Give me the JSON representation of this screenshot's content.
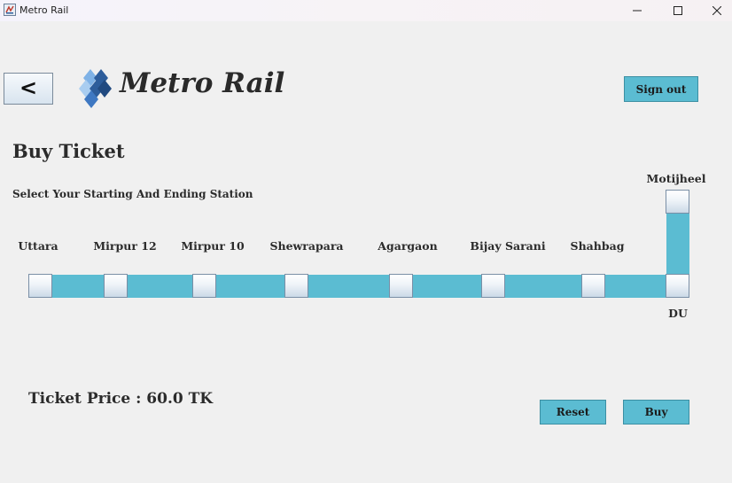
{
  "window": {
    "title": "Metro Rail",
    "controls": {
      "minimize": "minimize-icon",
      "maximize": "maximize-icon",
      "close": "close-icon"
    }
  },
  "header": {
    "back_label": "<",
    "brand": "Metro Rail",
    "sign_out_label": "Sign out"
  },
  "page": {
    "heading": "Buy Ticket",
    "instruction": "Select Your Starting And Ending Station"
  },
  "stations": [
    {
      "name": "Uttara"
    },
    {
      "name": "Mirpur 12"
    },
    {
      "name": "Mirpur 10"
    },
    {
      "name": "Shewrapara"
    },
    {
      "name": "Agargaon"
    },
    {
      "name": "Bijay Sarani"
    },
    {
      "name": "Shahbag"
    },
    {
      "name": "DU"
    },
    {
      "name": "Motijheel"
    }
  ],
  "ticket": {
    "price_text": "Ticket Price : 60.0 TK"
  },
  "actions": {
    "reset_label": "Reset",
    "buy_label": "Buy"
  },
  "colors": {
    "accent": "#5bbcd2",
    "background": "#f0f0f0",
    "logo_dark": "#2d5d9b",
    "logo_light": "#7fb2e6"
  }
}
